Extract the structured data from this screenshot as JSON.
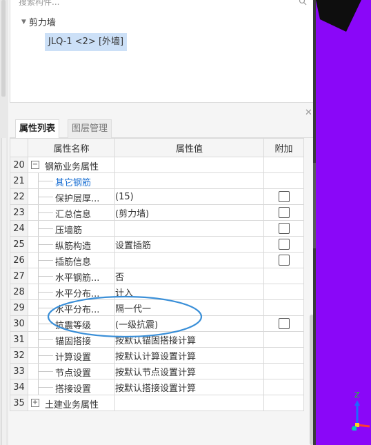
{
  "search": {
    "placeholder": "搜索构件..."
  },
  "tree": {
    "group": "剪力墙",
    "selected_item": "JLQ-1 <2> [外墙]"
  },
  "tabs": [
    {
      "label": "属性列表",
      "active": true
    },
    {
      "label": "图层管理",
      "active": false
    }
  ],
  "columns": {
    "name": "属性名称",
    "value": "属性值",
    "add": "附加"
  },
  "rows": [
    {
      "num": "20",
      "name": "钢筋业务属性",
      "value": "",
      "checkbox": false,
      "toggle": "−"
    },
    {
      "num": "21",
      "name": "其它钢筋",
      "value": "",
      "checkbox": false
    },
    {
      "num": "22",
      "name": "保护层厚...",
      "value": "(15)",
      "checkbox": true
    },
    {
      "num": "23",
      "name": "汇总信息",
      "value": "(剪力墙)",
      "checkbox": true
    },
    {
      "num": "24",
      "name": "压墙筋",
      "value": "",
      "checkbox": true
    },
    {
      "num": "25",
      "name": "纵筋构造",
      "value": "设置插筋",
      "checkbox": true
    },
    {
      "num": "26",
      "name": "插筋信息",
      "value": "",
      "checkbox": true
    },
    {
      "num": "27",
      "name": "水平钢筋...",
      "value": "否",
      "checkbox": false
    },
    {
      "num": "28",
      "name": "水平分布...",
      "value": "计入",
      "checkbox": false
    },
    {
      "num": "29",
      "name": "水平分布...",
      "value": "隔一代一",
      "checkbox": false
    },
    {
      "num": "30",
      "name": "抗震等级",
      "value": "(一级抗震)",
      "checkbox": true
    },
    {
      "num": "31",
      "name": "锚固搭接",
      "value": "按默认锚固搭接计算",
      "checkbox": false
    },
    {
      "num": "32",
      "name": "计算设置",
      "value": "按默认计算设置计算",
      "checkbox": false
    },
    {
      "num": "33",
      "name": "节点设置",
      "value": "按默认节点设置计算",
      "checkbox": false
    },
    {
      "num": "34",
      "name": "搭接设置",
      "value": "按默认搭接设置计算",
      "checkbox": false
    },
    {
      "num": "35",
      "name": "土建业务属性",
      "value": "",
      "checkbox": false,
      "toggle": "+"
    }
  ],
  "viewport": {
    "axis_label": "Z",
    "background": "#8a07f8"
  },
  "colors": {
    "accent_blue": "#1a6fd3",
    "annotation": "#3a8fd8"
  }
}
